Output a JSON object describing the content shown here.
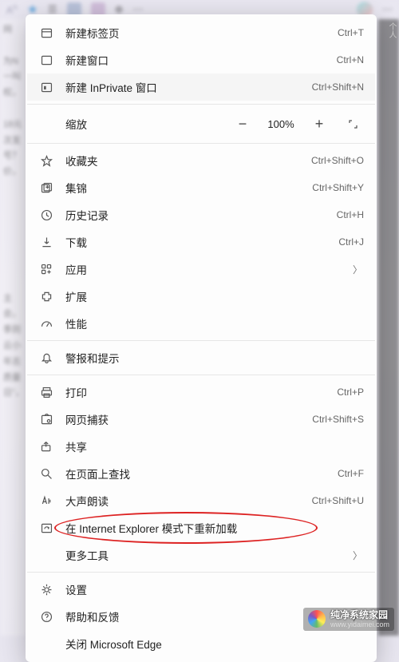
{
  "toolbar": {
    "text_size_label": "A",
    "profile_label": "个人"
  },
  "menu": {
    "new_tab": {
      "label": "新建标签页",
      "shortcut": "Ctrl+T"
    },
    "new_window": {
      "label": "新建窗口",
      "shortcut": "Ctrl+N"
    },
    "new_inprivate": {
      "label": "新建 InPrivate 窗口",
      "shortcut": "Ctrl+Shift+N"
    },
    "zoom": {
      "label": "缩放",
      "value": "100%"
    },
    "favorites": {
      "label": "收藏夹",
      "shortcut": "Ctrl+Shift+O"
    },
    "collections": {
      "label": "集锦",
      "shortcut": "Ctrl+Shift+Y"
    },
    "history": {
      "label": "历史记录",
      "shortcut": "Ctrl+H"
    },
    "downloads": {
      "label": "下载",
      "shortcut": "Ctrl+J"
    },
    "apps": {
      "label": "应用"
    },
    "extensions": {
      "label": "扩展"
    },
    "performance": {
      "label": "性能"
    },
    "alerts": {
      "label": "警报和提示"
    },
    "print": {
      "label": "打印",
      "shortcut": "Ctrl+P"
    },
    "capture": {
      "label": "网页捕获",
      "shortcut": "Ctrl+Shift+S"
    },
    "share": {
      "label": "共享"
    },
    "find": {
      "label": "在页面上查找",
      "shortcut": "Ctrl+F"
    },
    "read_aloud": {
      "label": "大声朗读",
      "shortcut": "Ctrl+Shift+U"
    },
    "ie_mode": {
      "label": "在 Internet Explorer 模式下重新加载"
    },
    "more_tools": {
      "label": "更多工具"
    },
    "settings": {
      "label": "设置"
    },
    "help": {
      "label": "帮助和反馈"
    },
    "close": {
      "label": "关闭 Microsoft Edge"
    }
  },
  "background": {
    "left_text": "网\n\n为N\n一叫\n权，\n\n18元\n次发\n号？\n价，\n\n\n\n\n\n\n\n主\n会，\n季则\n云小\n年志\n质量\n日\"，"
  },
  "watermark": {
    "title": "纯净系统家园",
    "url": "www.yidaimei.com"
  }
}
